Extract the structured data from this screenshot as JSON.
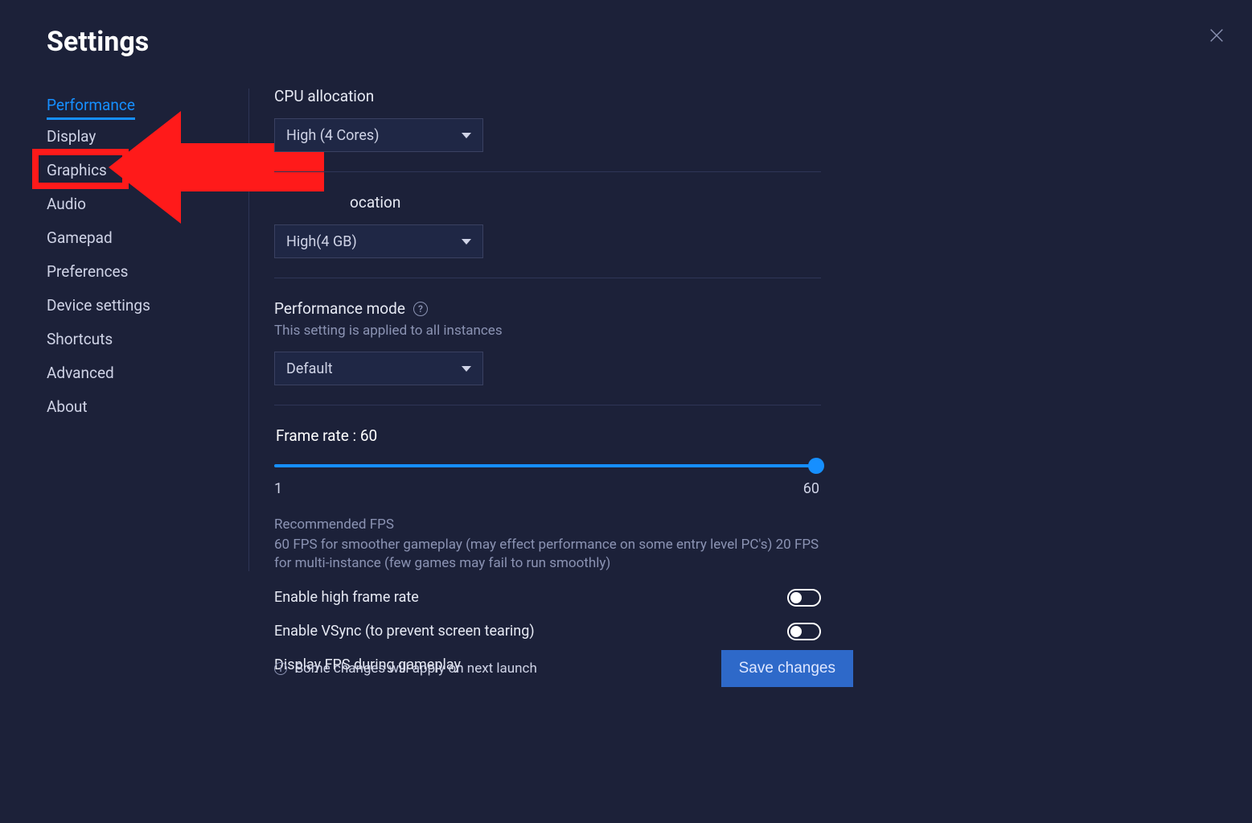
{
  "header": {
    "title": "Settings"
  },
  "sidebar": {
    "items": [
      {
        "label": "Performance",
        "active": true
      },
      {
        "label": "Display"
      },
      {
        "label": "Graphics",
        "highlighted": true
      },
      {
        "label": "Audio"
      },
      {
        "label": "Gamepad"
      },
      {
        "label": "Preferences"
      },
      {
        "label": "Device settings"
      },
      {
        "label": "Shortcuts"
      },
      {
        "label": "Advanced"
      },
      {
        "label": "About"
      }
    ]
  },
  "cpu": {
    "label": "CPU allocation",
    "value": "High (4 Cores)"
  },
  "memory": {
    "label_partial": "ocation",
    "value": "High(4 GB)"
  },
  "perfmode": {
    "label": "Performance mode",
    "sub": "This setting is applied to all instances",
    "value": "Default"
  },
  "frame": {
    "label": "Frame rate : 60",
    "min": "1",
    "max": "60",
    "value": 60
  },
  "recommended": {
    "title": "Recommended FPS",
    "body": "60 FPS for smoother gameplay (may effect performance on some entry level PC's) 20 FPS for multi-instance (few games may fail to run smoothly)"
  },
  "toggles": {
    "high_frame": {
      "label": "Enable high frame rate",
      "on": false
    },
    "vsync": {
      "label": "Enable VSync (to prevent screen tearing)",
      "on": false
    },
    "fps": {
      "label": "Display FPS during gameplay",
      "on": false
    }
  },
  "footer": {
    "note": "Some changes will apply on next launch",
    "save": "Save changes"
  }
}
